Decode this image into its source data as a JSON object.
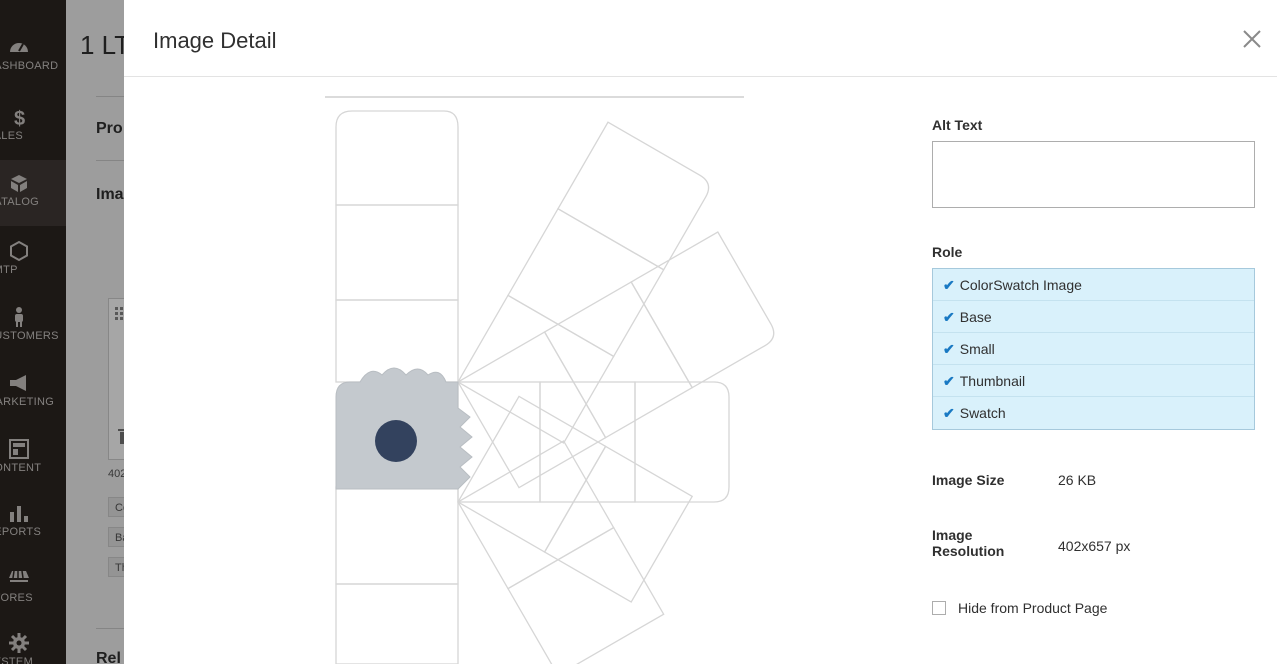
{
  "sidebar": {
    "items": [
      {
        "label": "DASHBOARD",
        "icon": "dashboard-icon"
      },
      {
        "label": "SALES",
        "icon": "dollar-icon"
      },
      {
        "label": "CATALOG",
        "icon": "box-icon"
      },
      {
        "label": "SMTP",
        "icon": "hexagon-icon"
      },
      {
        "label": "CUSTOMERS",
        "icon": "person-icon"
      },
      {
        "label": "MARKETING",
        "icon": "megaphone-icon"
      },
      {
        "label": "CONTENT",
        "icon": "layout-icon"
      },
      {
        "label": "REPORTS",
        "icon": "bar-chart-icon"
      },
      {
        "label": "STORES",
        "icon": "store-icon"
      },
      {
        "label": "SYSTEM",
        "icon": "gear-icon"
      }
    ]
  },
  "background_page": {
    "title": "1 LT",
    "section_1": "Pro",
    "section_2": "Ima",
    "image_meta": "402",
    "tags": [
      "Co",
      "Ba",
      "Th"
    ],
    "section_3": "Rel"
  },
  "modal": {
    "title": "Image Detail",
    "alt_text_label": "Alt Text",
    "alt_text_value": "",
    "role_label": "Role",
    "roles": [
      "ColorSwatch Image",
      "Base",
      "Small",
      "Thumbnail",
      "Swatch"
    ],
    "image_size_label": "Image Size",
    "image_size_value": "26 KB",
    "image_resolution_label_1": "Image",
    "image_resolution_label_2": "Resolution",
    "image_resolution_value": "402x657 px",
    "hide_label": "Hide from Product Page",
    "hide_checked": false
  },
  "colors": {
    "role_bg": "#d9f1fb",
    "check": "#1979c3",
    "preview_accent": "#33425e"
  }
}
